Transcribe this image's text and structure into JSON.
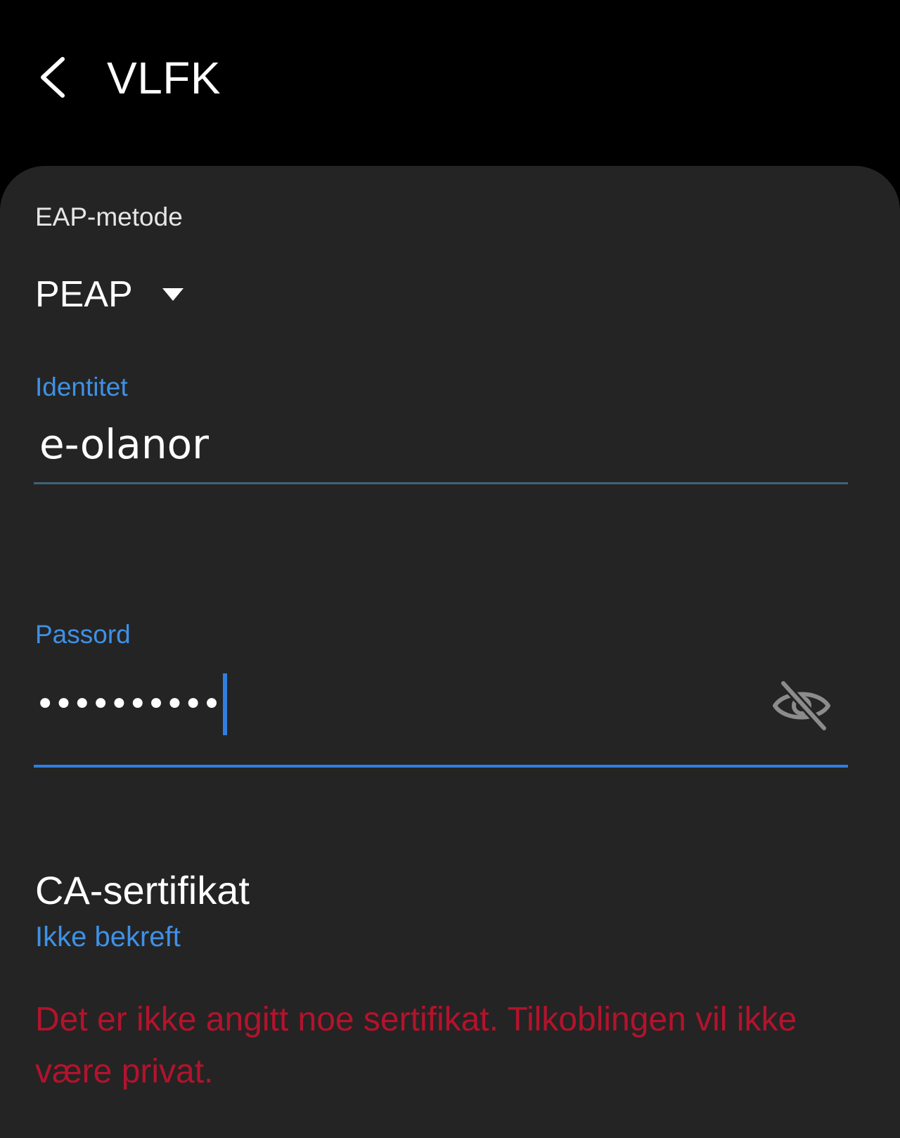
{
  "appbar": {
    "title": "VLFK"
  },
  "form": {
    "eap": {
      "label": "EAP-metode",
      "value": "PEAP"
    },
    "identity": {
      "label": "Identitet",
      "value": "e-olanor"
    },
    "password": {
      "label": "Passord",
      "masked_value": "••••••••••"
    },
    "ca_certificate": {
      "title": "CA-sertifikat",
      "value": "Ikke bekreft"
    },
    "warning": "Det er ikke angitt noe sertifikat. Tilkoblingen vil ikke være privat."
  },
  "icons": {
    "back": "chevron-left-icon",
    "dropdown": "triangle-down-icon",
    "visibility": "eye-off-icon"
  },
  "colors": {
    "background": "#000000",
    "card": "#242424",
    "accent": "#3e91e6",
    "focus": "#2f7fe0",
    "warning": "#b3132c"
  }
}
